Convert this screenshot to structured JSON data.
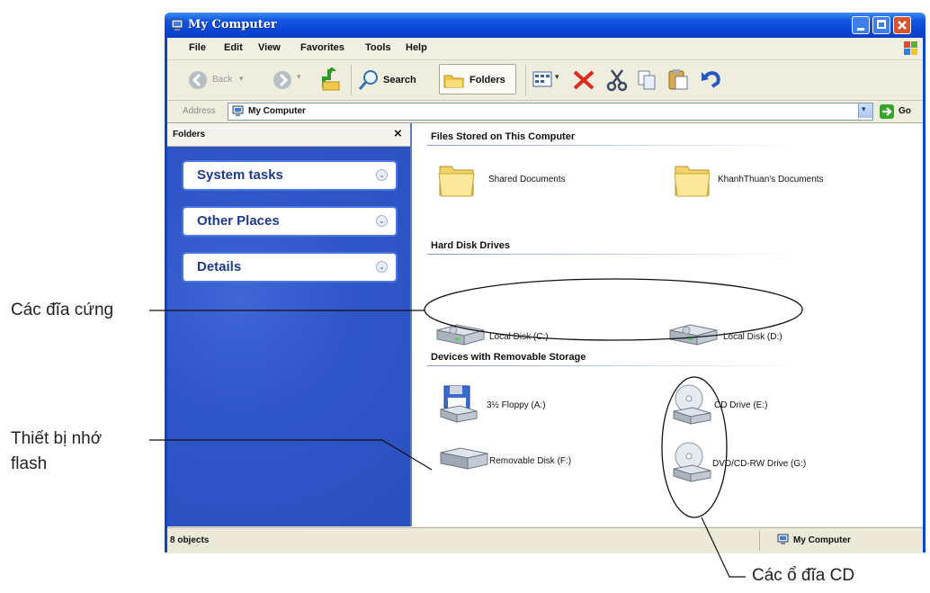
{
  "window": {
    "title": "My Computer"
  },
  "menu": [
    "File",
    "Edit",
    "View",
    "Favorites",
    "Tools",
    "Help"
  ],
  "toolbar": {
    "back": "Back",
    "search": "Search",
    "folders": "Folders"
  },
  "address": {
    "label": "Address",
    "value": "My Computer",
    "go": "Go"
  },
  "left_pane": {
    "header": "Folders",
    "close": "×",
    "tasks": [
      "System tasks",
      "Other Places",
      "Details"
    ]
  },
  "right_pane": {
    "groups": [
      {
        "title": "Files Stored on This Computer",
        "items": [
          "Shared Documents",
          "KhanhThuan's Documents"
        ]
      },
      {
        "title": "Hard Disk Drives",
        "items": [
          "Local Disk (C:)",
          "Local Disk (D:)"
        ]
      },
      {
        "title": "Devices with Removable Storage",
        "items": [
          "3½ Floppy (A:)",
          "CD Drive (E:)",
          "Removable Disk (F:)",
          "DVD/CD-RW Drive (G:)"
        ]
      }
    ]
  },
  "status": {
    "count": "8 objects",
    "location": "My Computer"
  },
  "annotations": {
    "hard_disks": "Các đĩa cứng",
    "flash_line1": "Thiết bị nhớ",
    "flash_line2": "flash",
    "cd_drives": "Các ổ đĩa CD"
  },
  "colors": {
    "titlebar": "#0a46d6",
    "task_pane": "#2f56c8",
    "window_bg": "#ece9d8"
  }
}
